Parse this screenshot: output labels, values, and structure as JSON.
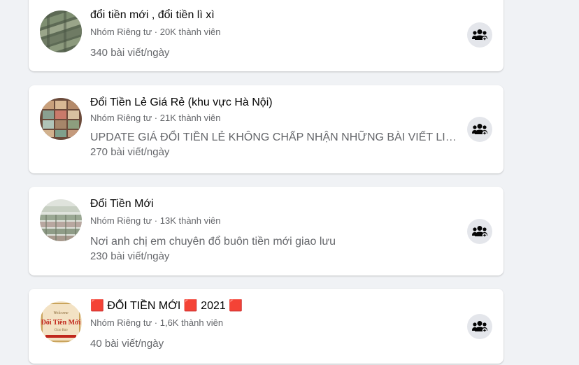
{
  "groups": [
    {
      "name": "đổi tiền mới , đổi tiền lì xì",
      "meta": "Nhóm Riêng tư · 20K thành viên",
      "description": "",
      "posts": "340 bài viết/ngày",
      "avatar_icon": "money-bundles-photo"
    },
    {
      "name": "Đổi Tiền Lẻ Giá Rẻ (khu vực Hà Nội)",
      "meta": "Nhóm Riêng tư · 21K thành viên",
      "description": "UPDATE GIÁ ĐỔI TIỀN LẺ KHÔNG CHẤP NHẬN NHỮNG BÀI VIẾT LIÊN QUAN ...",
      "posts": "270 bài viết/ngày",
      "avatar_icon": "money-stacks-photo"
    },
    {
      "name": "Đổi Tiền Mới",
      "meta": "Nhóm Riêng tư · 13K thành viên",
      "description": "Nơi anh chị em chuyên đổ buôn tiền mới giao lưu",
      "posts": "230 bài viết/ngày",
      "avatar_icon": "money-bricks-photo"
    },
    {
      "name": "🟥 ĐỔI TIỀN MỚI 🟥 2021 🟥",
      "meta": "Nhóm Riêng tư · 1,6K thành viên",
      "description": "",
      "posts": "40 bài viết/ngày",
      "avatar_icon": "logo-badge",
      "avatar_logo_text": "Đổi Tiền Mới"
    }
  ],
  "join_icon": "add-group-icon",
  "colors": {
    "background": "#f0f2f5",
    "card": "#ffffff",
    "name_text": "#050505",
    "secondary_text": "#65676b",
    "button_bg": "#e4e6eb"
  }
}
